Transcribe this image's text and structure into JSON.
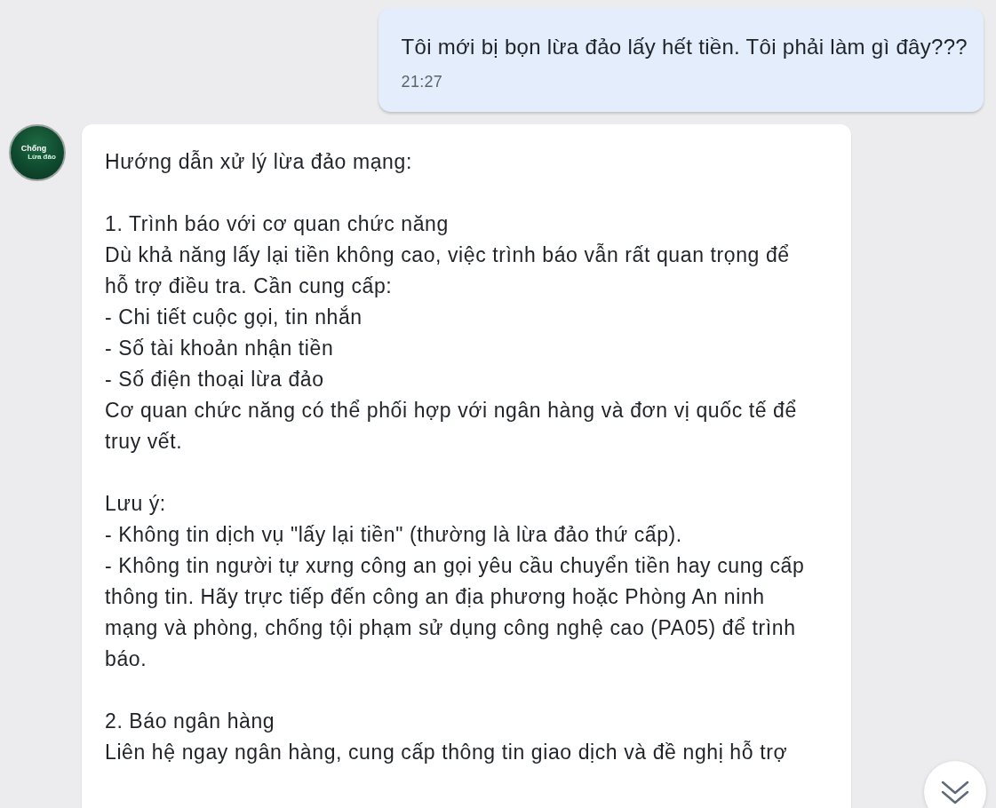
{
  "user_message": {
    "text": "Tôi mới bị bọn lừa đảo lấy hết tiền. Tôi phải làm gì đây???",
    "time": "21:27"
  },
  "bot_message": {
    "avatar": {
      "logo_lines": [
        "Chống",
        "Lừa đảo"
      ]
    },
    "paragraphs": [
      [
        "Hướng dẫn xử lý lừa đảo mạng:"
      ],
      [
        "1. Trình báo với cơ quan chức năng",
        "Dù khả năng lấy lại tiền không cao, việc trình báo vẫn rất quan trọng để hỗ trợ điều tra. Cần cung cấp:",
        "- Chi tiết cuộc gọi, tin nhắn",
        "- Số tài khoản nhận tiền",
        "- Số điện thoại lừa đảo",
        "Cơ quan chức năng có thể phối hợp với ngân hàng và đơn vị quốc tế để truy vết."
      ],
      [
        "Lưu ý:",
        "- Không tin dịch vụ \"lấy lại tiền\" (thường là lừa đảo thứ cấp).",
        "- Không tin người tự xưng công an gọi yêu cầu chuyển tiền hay cung cấp thông tin. Hãy trực tiếp đến công an địa phương hoặc Phòng An ninh mạng và phòng, chống tội phạm sử dụng công nghệ cao (PA05) để trình báo."
      ],
      [
        "2. Báo ngân hàng",
        "Liên hệ ngay ngân hàng, cung cấp thông tin giao dịch và đề nghị hỗ trợ"
      ]
    ]
  }
}
